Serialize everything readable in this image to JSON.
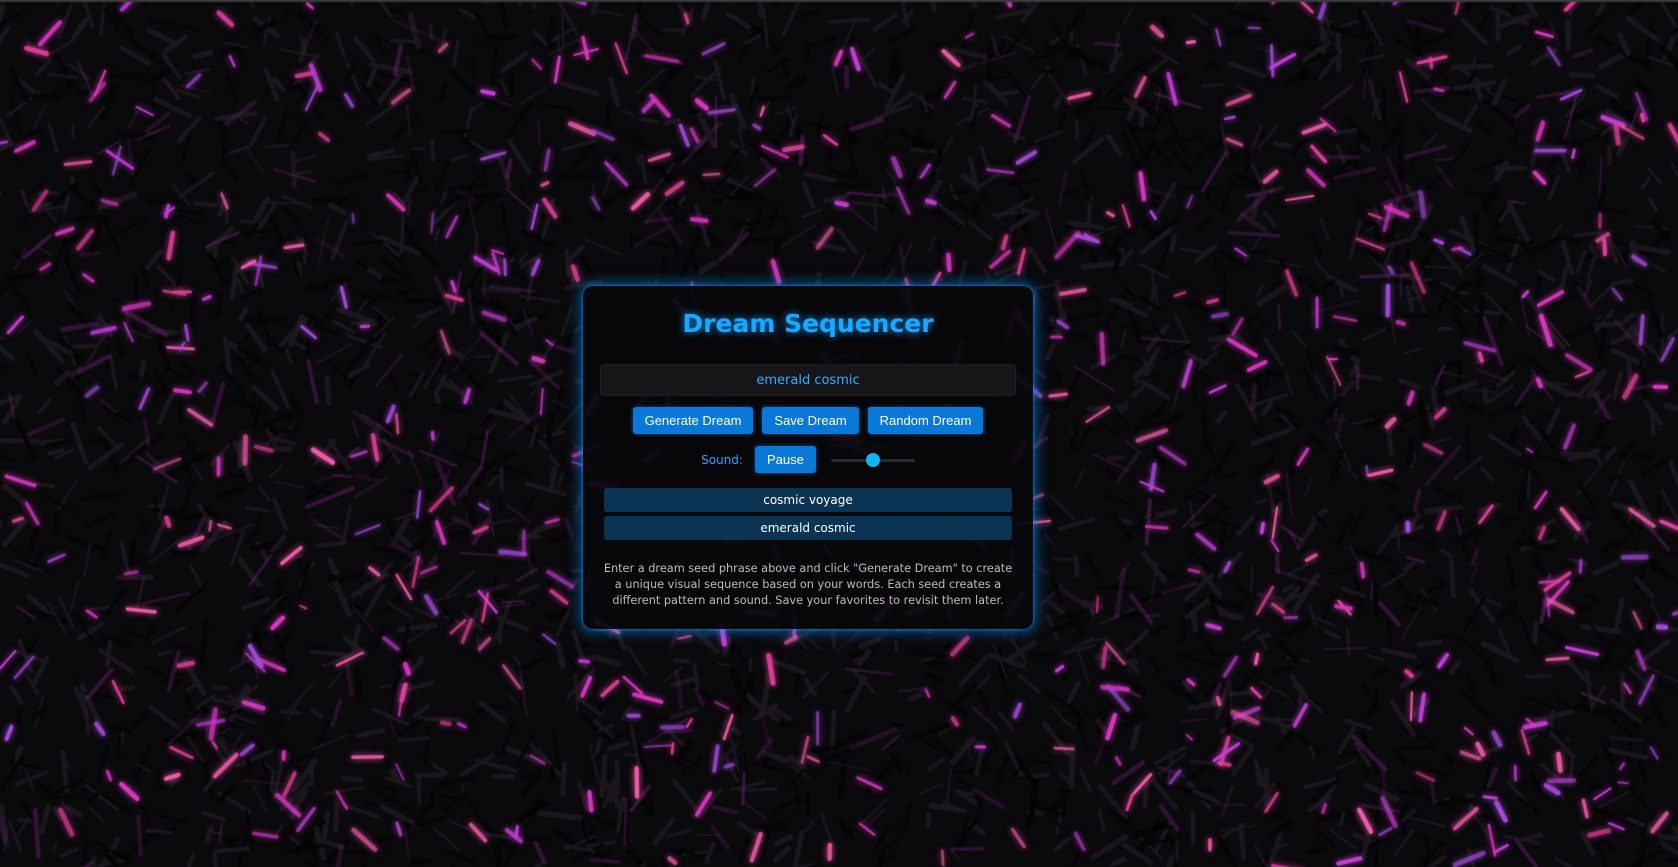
{
  "app": {
    "title": "Dream Sequencer"
  },
  "seed_input": {
    "value": "emerald cosmic"
  },
  "buttons": {
    "generate": "Generate Dream",
    "save": "Save Dream",
    "random": "Random Dream"
  },
  "sound": {
    "label": "Sound:",
    "toggle_label": "Pause",
    "volume": 0.5
  },
  "saved_dreams": [
    "cosmic voyage",
    "emerald cosmic"
  ],
  "info_text": "Enter a dream seed phrase above and click \"Generate Dream\" to create a unique visual sequence based on your words. Each seed creates a different pattern and sound. Save your favorites to revisit them later.",
  "colors": {
    "accent": "#1aa9ff",
    "button": "#0a78d7",
    "saved_item": "#0a3354",
    "background": "#0a090b",
    "particle_pink": "#e0409a",
    "particle_violet": "#a24bd8"
  }
}
